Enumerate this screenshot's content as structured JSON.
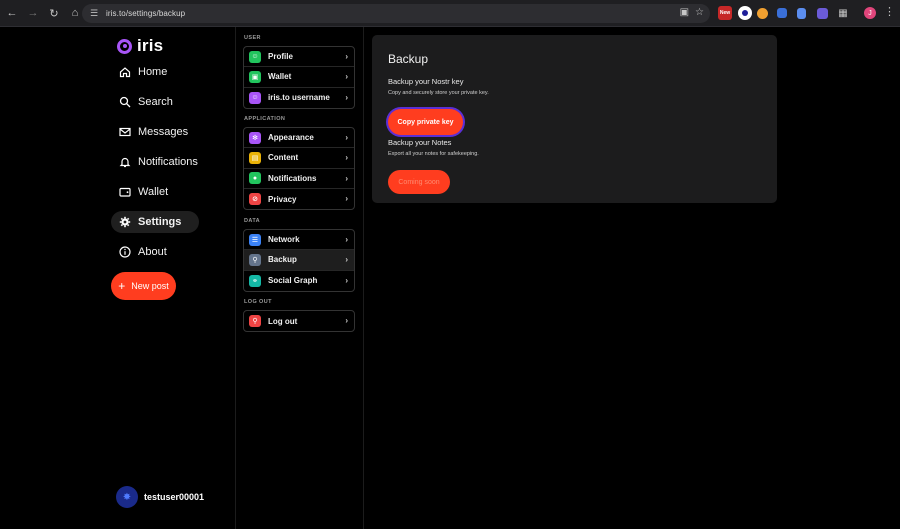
{
  "browser": {
    "url": "iris.to/settings/backup",
    "ext_new_badge": "New",
    "profile_initial": "J"
  },
  "app": {
    "logo_text": "iris",
    "nav": [
      {
        "label": "Home",
        "icon": "home-icon"
      },
      {
        "label": "Search",
        "icon": "search-icon"
      },
      {
        "label": "Messages",
        "icon": "mail-icon"
      },
      {
        "label": "Notifications",
        "icon": "bell-icon"
      },
      {
        "label": "Wallet",
        "icon": "wallet-icon"
      },
      {
        "label": "Settings",
        "icon": "gear-icon",
        "active": true
      },
      {
        "label": "About",
        "icon": "info-icon"
      }
    ],
    "new_post_label": "New post",
    "username": "testuser00001"
  },
  "settings": {
    "sections": [
      {
        "label": "USER",
        "items": [
          {
            "label": "Profile",
            "color": "#22c55e"
          },
          {
            "label": "Wallet",
            "color": "#22c55e"
          },
          {
            "label": "iris.to username",
            "color": "#a855f7"
          }
        ]
      },
      {
        "label": "APPLICATION",
        "items": [
          {
            "label": "Appearance",
            "color": "#a855f7"
          },
          {
            "label": "Content",
            "color": "#eab308"
          },
          {
            "label": "Notifications",
            "color": "#22c55e"
          },
          {
            "label": "Privacy",
            "color": "#ef4444"
          }
        ]
      },
      {
        "label": "DATA",
        "items": [
          {
            "label": "Network",
            "color": "#3b82f6"
          },
          {
            "label": "Backup",
            "color": "#64748b",
            "active": true
          },
          {
            "label": "Social Graph",
            "color": "#14b8a6"
          }
        ]
      },
      {
        "label": "LOG OUT",
        "items": [
          {
            "label": "Log out",
            "color": "#ef4444"
          }
        ]
      }
    ]
  },
  "backup": {
    "title": "Backup",
    "key_heading": "Backup your Nostr key",
    "key_desc": "Copy and securely store your private key.",
    "copy_label": "Copy private key",
    "notes_heading": "Backup your Notes",
    "notes_desc": "Export all your notes for safekeeping.",
    "soon_label": "Coming soon"
  },
  "colors": {
    "accent": "#ff3d1f",
    "brand": "#a855f7",
    "card_bg": "#1c1c1d"
  }
}
